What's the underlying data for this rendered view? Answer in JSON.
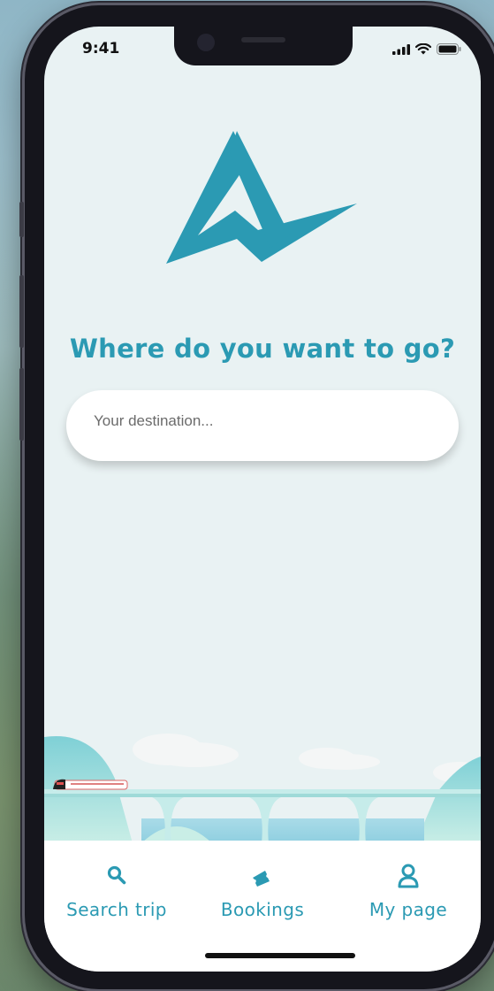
{
  "status_bar": {
    "time": "9:41",
    "signal_icon": "signal-icon",
    "wifi_icon": "wifi-icon",
    "battery_icon": "battery-icon"
  },
  "logo": {
    "icon": "brand-logo-icon",
    "color": "#2b9ab3"
  },
  "main": {
    "headline": "Where do you want to go?"
  },
  "search": {
    "placeholder": "Your destination...",
    "value": ""
  },
  "tabbar": {
    "tabs": [
      {
        "label": "Search trip",
        "icon": "search-icon"
      },
      {
        "label": "Bookings",
        "icon": "ticket-icon"
      },
      {
        "label": "My page",
        "icon": "user-icon"
      }
    ]
  },
  "colors": {
    "accent": "#2b9ab3",
    "screen_bg": "#e9f2f3",
    "tabbar_bg": "#ffffff"
  }
}
